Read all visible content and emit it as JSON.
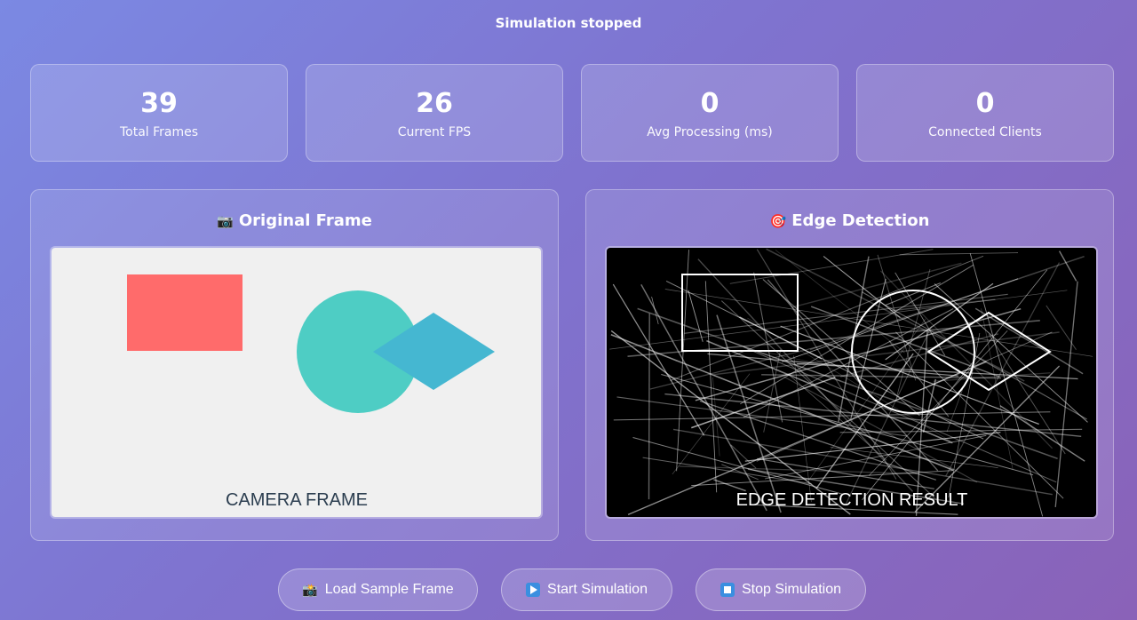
{
  "status": {
    "text": "Simulation stopped"
  },
  "stats": [
    {
      "value": "39",
      "label": "Total Frames"
    },
    {
      "value": "26",
      "label": "Current FPS"
    },
    {
      "value": "0",
      "label": "Avg Processing (ms)"
    },
    {
      "value": "0",
      "label": "Connected Clients"
    }
  ],
  "panels": {
    "original": {
      "icon": "camera-icon",
      "emoji": "📷",
      "title": "Original Frame",
      "caption": "CAMERA FRAME"
    },
    "edge": {
      "icon": "target-icon",
      "emoji": "🎯",
      "title": "Edge Detection",
      "caption": "EDGE DETECTION RESULT"
    }
  },
  "buttons": {
    "load": {
      "icon": "camera-icon",
      "emoji": "📸",
      "label": "Load Sample Frame"
    },
    "start": {
      "icon": "play-icon",
      "label": "Start Simulation"
    },
    "stop": {
      "icon": "stop-icon",
      "label": "Stop Simulation"
    }
  },
  "colors": {
    "rectangle": "#ff6b6b",
    "circle": "#4ecdc4",
    "diamond": "#45b7d1",
    "frame_bg": "#f0f0f0",
    "caption_text": "#2c3e50"
  }
}
